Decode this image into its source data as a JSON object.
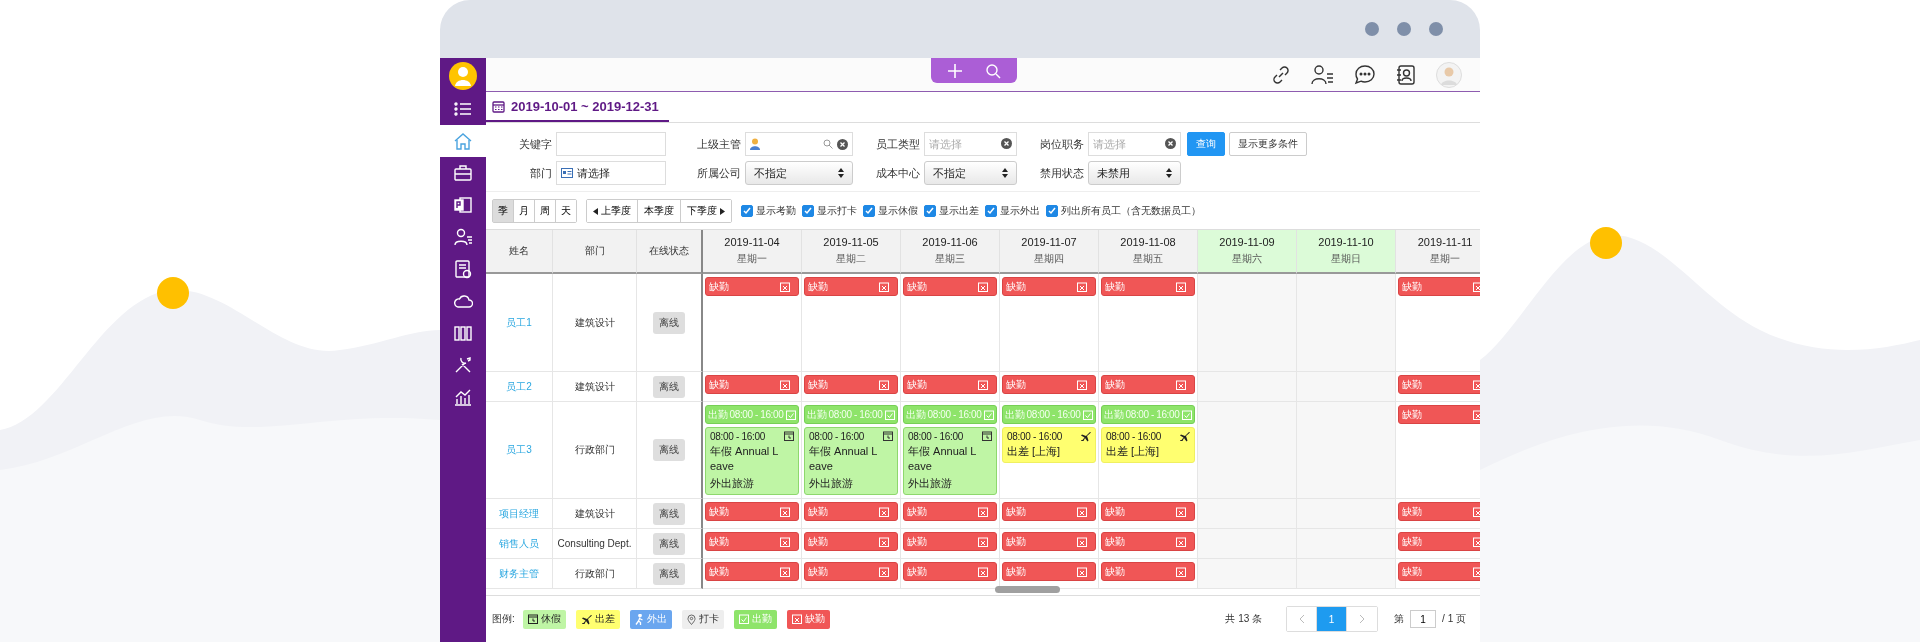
{
  "sidebar": {
    "items": [
      {
        "selected": false
      },
      {
        "selected": true
      },
      {
        "selected": false
      },
      {
        "selected": false
      },
      {
        "selected": false
      },
      {
        "selected": false
      },
      {
        "selected": false
      },
      {
        "selected": false
      },
      {
        "selected": false
      },
      {
        "selected": false
      }
    ]
  },
  "date_tab": {
    "label": "2019-10-01 ~ 2019-12-31",
    "selected": true
  },
  "filter_rows": [
    [
      {
        "label": "关键字",
        "kind": "text"
      },
      {
        "label": "上级主管",
        "kind": "person"
      },
      {
        "label": "员工类型",
        "kind": "clear",
        "placeholder": "请选择"
      },
      {
        "label": "岗位职务",
        "kind": "clear",
        "placeholder": "请选择"
      }
    ],
    [
      {
        "label": "部门",
        "kind": "dept",
        "value": "请选择"
      },
      {
        "label": "所属公司",
        "kind": "select",
        "value": "不指定"
      },
      {
        "label": "成本中心",
        "kind": "select",
        "value": "不指定"
      },
      {
        "label": "禁用状态",
        "kind": "select",
        "value": "未禁用"
      }
    ]
  ],
  "buttons": [
    {
      "label": "查询",
      "kind": "primary"
    },
    {
      "label": "显示更多条件",
      "kind": "default"
    }
  ],
  "view_modes": [
    {
      "label": "季",
      "selected": true
    },
    {
      "label": "月",
      "selected": false
    },
    {
      "label": "周",
      "selected": false
    },
    {
      "label": "天",
      "selected": false
    }
  ],
  "period_nav": [
    {
      "label": "上季度",
      "kind": "prev"
    },
    {
      "label": "本季度",
      "kind": "current"
    },
    {
      "label": "下季度",
      "kind": "next"
    }
  ],
  "options": [
    {
      "label": "显示考勤",
      "checked": true
    },
    {
      "label": "显示打卡",
      "checked": true
    },
    {
      "label": "显示休假",
      "checked": true
    },
    {
      "label": "显示出差",
      "checked": true
    },
    {
      "label": "显示外出",
      "checked": true
    },
    {
      "label": "列出所有员工（含无数据员工）",
      "checked": true
    }
  ],
  "table": {
    "columns": [
      "姓名",
      "部门",
      "在线状态"
    ],
    "days": [
      {
        "date": "2019-11-04",
        "weekday": "星期一",
        "weekend": false
      },
      {
        "date": "2019-11-05",
        "weekday": "星期二",
        "weekend": false
      },
      {
        "date": "2019-11-06",
        "weekday": "星期三",
        "weekend": false
      },
      {
        "date": "2019-11-07",
        "weekday": "星期四",
        "weekend": false
      },
      {
        "date": "2019-11-08",
        "weekday": "星期五",
        "weekend": false
      },
      {
        "date": "2019-11-09",
        "weekday": "星期六",
        "weekend": true
      },
      {
        "date": "2019-11-10",
        "weekday": "星期日",
        "weekend": true
      },
      {
        "date": "2019-11-11",
        "weekday": "星期一",
        "weekend": false
      }
    ],
    "rows": [
      {
        "name": "员工1",
        "dept": "建筑设计",
        "status": "离线",
        "cells": [
          [
            {
              "kind": "absent",
              "label": "缺勤"
            }
          ],
          [
            {
              "kind": "absent",
              "label": "缺勤"
            }
          ],
          [
            {
              "kind": "absent",
              "label": "缺勤"
            }
          ],
          [
            {
              "kind": "absent",
              "label": "缺勤"
            }
          ],
          [
            {
              "kind": "absent",
              "label": "缺勤"
            }
          ],
          [],
          [],
          [
            {
              "kind": "absent",
              "label": "缺勤"
            }
          ]
        ]
      },
      {
        "name": "员工2",
        "dept": "建筑设计",
        "status": "离线",
        "cells": [
          [
            {
              "kind": "absent",
              "label": "缺勤"
            }
          ],
          [
            {
              "kind": "absent",
              "label": "缺勤"
            }
          ],
          [
            {
              "kind": "absent",
              "label": "缺勤"
            }
          ],
          [
            {
              "kind": "absent",
              "label": "缺勤"
            }
          ],
          [
            {
              "kind": "absent",
              "label": "缺勤"
            }
          ],
          [],
          [],
          [
            {
              "kind": "absent",
              "label": "缺勤"
            }
          ]
        ]
      },
      {
        "name": "员工3",
        "dept": "行政部门",
        "status": "离线",
        "cells": [
          [
            {
              "kind": "attend",
              "label": "出勤 08:00 - 16:00"
            },
            {
              "kind": "leave",
              "time": "08:00 - 16:00",
              "title": "年假 Annual Leave",
              "note": "外出旅游"
            }
          ],
          [
            {
              "kind": "attend",
              "label": "出勤 08:00 - 16:00"
            },
            {
              "kind": "leave",
              "time": "08:00 - 16:00",
              "title": "年假 Annual Leave",
              "note": "外出旅游"
            }
          ],
          [
            {
              "kind": "attend",
              "label": "出勤 08:00 - 16:00"
            },
            {
              "kind": "leave",
              "time": "08:00 - 16:00",
              "title": "年假 Annual Leave",
              "note": "外出旅游"
            }
          ],
          [
            {
              "kind": "attend",
              "label": "出勤 08:00 - 16:00"
            },
            {
              "kind": "trip",
              "time": "08:00 - 16:00",
              "title": "出差 [上海]"
            }
          ],
          [
            {
              "kind": "attend",
              "label": "出勤 08:00 - 16:00"
            },
            {
              "kind": "trip",
              "time": "08:00 - 16:00",
              "title": "出差 [上海]"
            }
          ],
          [],
          [],
          [
            {
              "kind": "absent",
              "label": "缺勤"
            }
          ]
        ]
      },
      {
        "name": "项目经理",
        "dept": "建筑设计",
        "status": "离线",
        "cells": [
          [
            {
              "kind": "absent",
              "label": "缺勤"
            }
          ],
          [
            {
              "kind": "absent",
              "label": "缺勤"
            }
          ],
          [
            {
              "kind": "absent",
              "label": "缺勤"
            }
          ],
          [
            {
              "kind": "absent",
              "label": "缺勤"
            }
          ],
          [
            {
              "kind": "absent",
              "label": "缺勤"
            }
          ],
          [],
          [],
          [
            {
              "kind": "absent",
              "label": "缺勤"
            }
          ]
        ]
      },
      {
        "name": "销售人员",
        "dept": "Consulting Dept.",
        "status": "离线",
        "cells": [
          [
            {
              "kind": "absent",
              "label": "缺勤"
            }
          ],
          [
            {
              "kind": "absent",
              "label": "缺勤"
            }
          ],
          [
            {
              "kind": "absent",
              "label": "缺勤"
            }
          ],
          [
            {
              "kind": "absent",
              "label": "缺勤"
            }
          ],
          [
            {
              "kind": "absent",
              "label": "缺勤"
            }
          ],
          [],
          [],
          [
            {
              "kind": "absent",
              "label": "缺勤"
            }
          ]
        ]
      },
      {
        "name": "财务主管",
        "dept": "行政部门",
        "status": "离线",
        "cells": [
          [
            {
              "kind": "absent",
              "label": "缺勤"
            }
          ],
          [
            {
              "kind": "absent",
              "label": "缺勤"
            }
          ],
          [
            {
              "kind": "absent",
              "label": "缺勤"
            }
          ],
          [
            {
              "kind": "absent",
              "label": "缺勤"
            }
          ],
          [
            {
              "kind": "absent",
              "label": "缺勤"
            }
          ],
          [],
          [],
          [
            {
              "kind": "absent",
              "label": "缺勤"
            }
          ]
        ]
      }
    ]
  },
  "legend": {
    "label": "图例:",
    "items": [
      {
        "kind": "leave",
        "label": "休假"
      },
      {
        "kind": "trip",
        "label": "出差"
      },
      {
        "kind": "out",
        "label": "外出"
      },
      {
        "kind": "clock",
        "label": "打卡"
      },
      {
        "kind": "attend",
        "label": "出勤"
      },
      {
        "kind": "absent",
        "label": "缺勤"
      }
    ]
  },
  "pagination": {
    "total": "共 13 条",
    "pages": [
      {
        "label": "1",
        "selected": true
      }
    ],
    "page_prefix": "第",
    "page_value": "1",
    "page_suffix": "/ 1 页"
  }
}
